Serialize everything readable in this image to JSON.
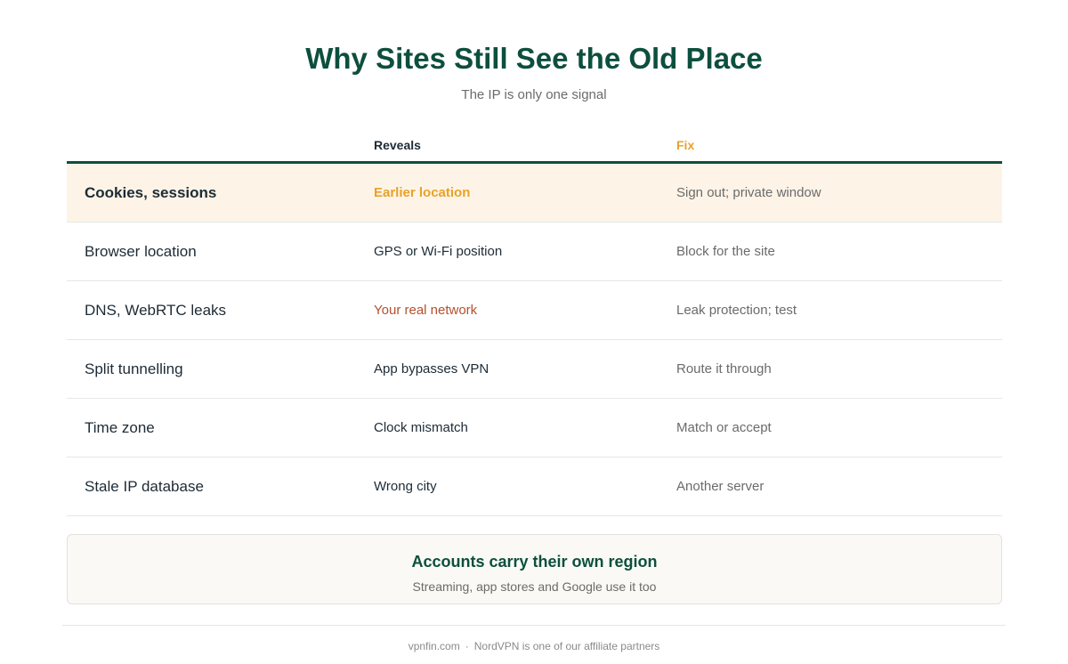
{
  "header": {
    "title": "Why Sites Still See the Old Place",
    "subtitle": "The IP is only one signal"
  },
  "table": {
    "columns": [
      "",
      "Reveals",
      "Fix"
    ],
    "rows": [
      {
        "signal": "Cookies, sessions",
        "reveals": "Earlier location",
        "fix": "Sign out; private window"
      },
      {
        "signal": "Browser location",
        "reveals": "GPS or Wi-Fi position",
        "fix": "Block for the site"
      },
      {
        "signal": "DNS, WebRTC leaks",
        "reveals": "Your real network",
        "fix": "Leak protection; test"
      },
      {
        "signal": "Split tunnelling",
        "reveals": "App bypasses VPN",
        "fix": "Route it through"
      },
      {
        "signal": "Time zone",
        "reveals": "Clock mismatch",
        "fix": "Match or accept"
      },
      {
        "signal": "Stale IP database",
        "reveals": "Wrong city",
        "fix": "Another server"
      }
    ]
  },
  "callout": {
    "title": "Accounts carry their own region",
    "text": "Streaming, app stores and Google use it too"
  },
  "footer": {
    "site": "vpnfin.com",
    "separator": "·",
    "note": "NordVPN is one of our affiliate partners"
  },
  "colors": {
    "brand_green": "#0d4f3e",
    "accent_amber": "#e8a228",
    "warning_red": "#b5502b",
    "highlight_bg": "#fdf4e7"
  }
}
